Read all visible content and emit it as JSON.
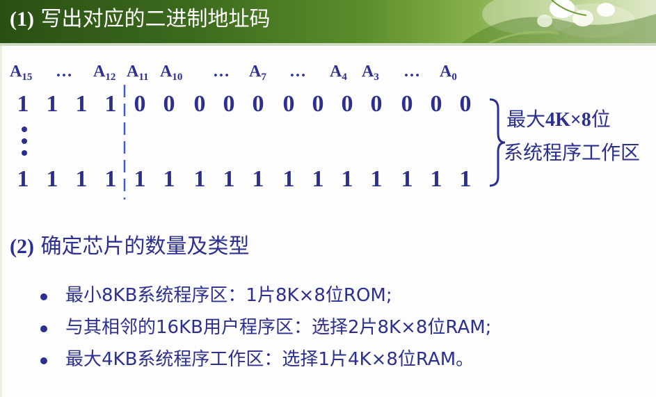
{
  "header": {
    "title_num": "(1)",
    "title_text": "写出对应的二进制地址码"
  },
  "address": {
    "labels": [
      {
        "name": "A",
        "sub": "15"
      },
      {
        "name": "A",
        "sub": "12"
      },
      {
        "name": "A",
        "sub": "11"
      },
      {
        "name": "A",
        "sub": "10"
      },
      {
        "name": "A",
        "sub": "7"
      },
      {
        "name": "A",
        "sub": "4"
      },
      {
        "name": "A",
        "sub": "3"
      },
      {
        "name": "A",
        "sub": "0"
      }
    ],
    "ellipsis": "…",
    "row_start": [
      "1",
      "1",
      "1",
      "1",
      "0",
      "0",
      "0",
      "0",
      "0",
      "0",
      "0",
      "0",
      "0",
      "0",
      "0",
      "0"
    ],
    "row_end": [
      "1",
      "1",
      "1",
      "1",
      "1",
      "1",
      "1",
      "1",
      "1",
      "1",
      "1",
      "1",
      "1",
      "1",
      "1",
      "1"
    ],
    "brace_line1": {
      "pre": "最大",
      "bold": "4K×8",
      "post": "位"
    },
    "brace_line2": "系统程序工作区",
    "colors": {
      "text": "#2b2f8f",
      "divider": "#3a5fd0"
    }
  },
  "section2": {
    "title_num": "(2)",
    "title_text": "确定芯片的数量及类型",
    "bullets": [
      "最小8KB系统程序区：1片8K×8位ROM;",
      "与其相邻的16KB用户程序区：选择2片8K×8位RAM;",
      "最大4KB系统程序工作区：选择1片4K×8位RAM。"
    ]
  }
}
